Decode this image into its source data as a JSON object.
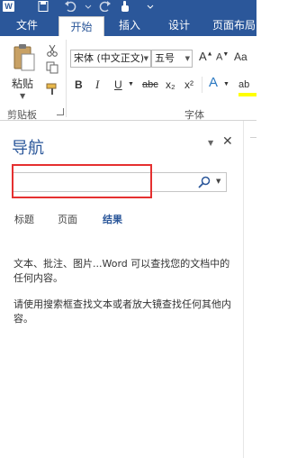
{
  "quick_access": {
    "app_icon": "W",
    "icons": [
      "word-app-icon",
      "save-icon",
      "undo-icon",
      "undo-dropdown-icon",
      "redo-icon",
      "touch-mode-icon",
      "customize-qat-icon"
    ]
  },
  "tabs": {
    "file": "文件",
    "home": "开始",
    "insert": "插入",
    "design": "设计",
    "layout": "页面布局"
  },
  "ribbon": {
    "clipboard": {
      "paste_label": "粘贴",
      "group_label": "剪贴板"
    },
    "font": {
      "font_name": "宋体 (中文正文)",
      "font_size": "五号",
      "grow": "A",
      "shrink": "A",
      "case": "Aa",
      "bold": "B",
      "italic": "I",
      "underline": "U",
      "strike": "abc",
      "subscript": "x₂",
      "superscript": "x²",
      "effects": "A",
      "highlight": "ab",
      "group_label": "字体"
    }
  },
  "nav_pane": {
    "title": "导航",
    "search_value": "",
    "tabs": [
      "标题",
      "页面",
      "结果"
    ],
    "active_tab": "结果",
    "message_1": "文本、批注、图片...Word 可以查找您的文档中的任何内容。",
    "message_2": "请使用搜索框查找文本或者放大镜查找任何其他内容。"
  },
  "colors": {
    "accent": "#2b579a",
    "highlight_box": "#e53030",
    "highlight_color": "#ffff00"
  }
}
